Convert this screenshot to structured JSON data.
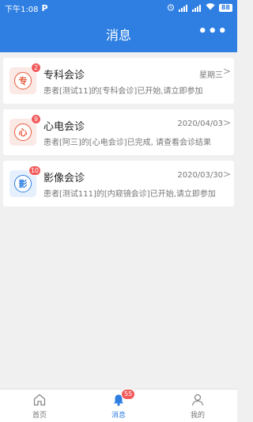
{
  "statusbar": {
    "time": "下午1:08",
    "app_icon": "P",
    "battery": "88"
  },
  "header": {
    "title": "消息",
    "more_icon": "more-dots-icon"
  },
  "messages": [
    {
      "name": "专科会诊",
      "icon_text": "专",
      "badge": "2",
      "date": "星期三",
      "desc": "患者[测试11]的[专科会诊]已开始,请立即参加",
      "color": "#e85a3c"
    },
    {
      "name": "心电会诊",
      "icon_text": "心",
      "badge": "9",
      "date": "2020/04/03",
      "desc": "患者[阿三]的[心电会诊]已完成, 请查看会诊结果",
      "color": "#e85a3c"
    },
    {
      "name": "影像会诊",
      "icon_text": "影",
      "badge": "10",
      "date": "2020/03/30",
      "desc": "患者[测试111]的[内窥镜会诊]已开始,请立即参加",
      "color": "#2f7fe2"
    }
  ],
  "nav": {
    "home": "首页",
    "messages": "消息",
    "messages_badge": "55",
    "mine": "我的"
  }
}
